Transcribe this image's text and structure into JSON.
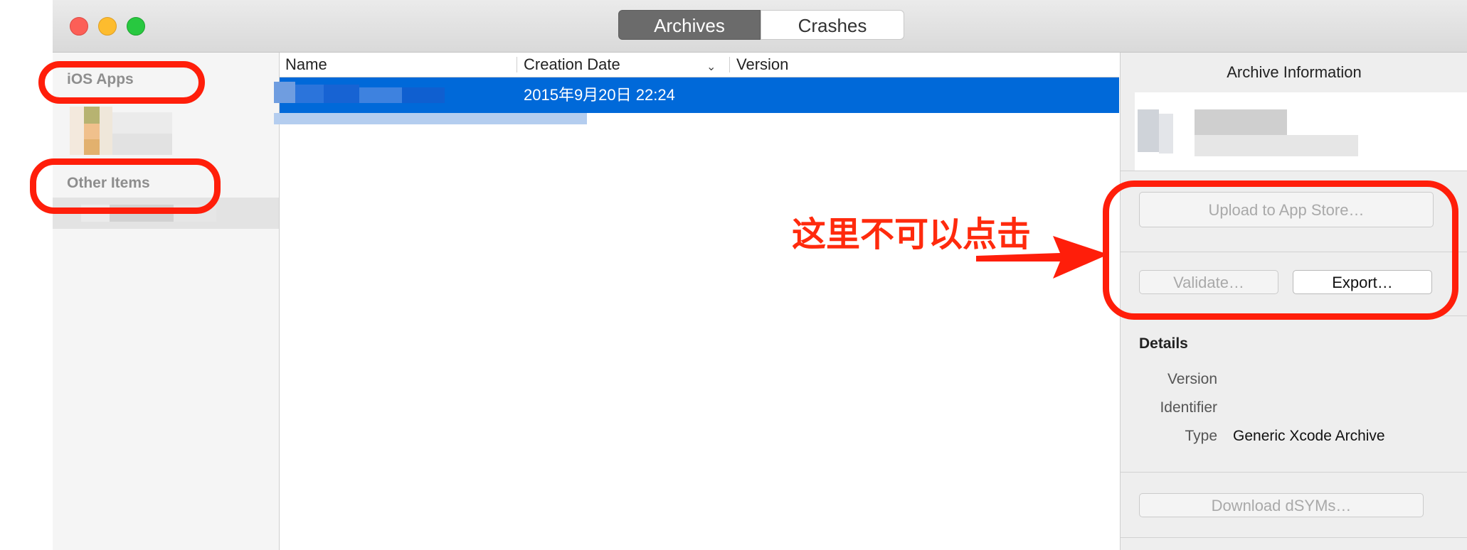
{
  "titlebar": {
    "tabs": [
      {
        "label": "Archives",
        "active": true
      },
      {
        "label": "Crashes",
        "active": false
      }
    ]
  },
  "sidebar": {
    "sections": [
      {
        "heading": "iOS Apps"
      },
      {
        "heading": "Other Items"
      }
    ]
  },
  "list": {
    "columns": [
      "Name",
      "Creation Date",
      "Version"
    ],
    "selected_row": {
      "creation_date": "2015年9月20日 22:24",
      "version": ""
    }
  },
  "info_panel": {
    "title": "Archive Information",
    "upload_label": "Upload to App Store…",
    "validate_label": "Validate…",
    "export_label": "Export…",
    "details": {
      "heading": "Details",
      "rows": [
        {
          "label": "Version",
          "value": ""
        },
        {
          "label": "Identifier",
          "value": ""
        },
        {
          "label": "Type",
          "value": "Generic Xcode Archive"
        }
      ]
    },
    "dsyms_label": "Download dSYMs…"
  },
  "annotation": {
    "text": "这里不可以点击",
    "color": "#ff1e0a"
  },
  "colors": {
    "selection": "#0069d9",
    "active_tab": "#6b6b6b"
  }
}
